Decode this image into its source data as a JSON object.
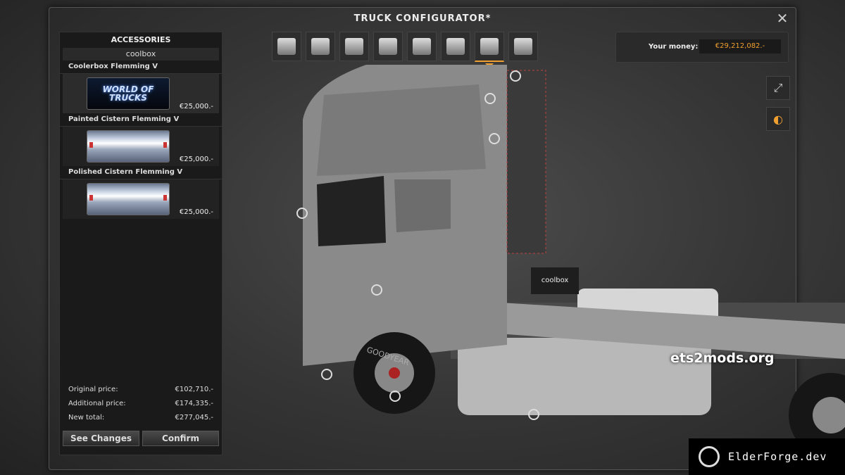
{
  "window": {
    "title": "TRUCK CONFIGURATOR*",
    "close_glyph": "✕"
  },
  "sidebar": {
    "header": "ACCESSORIES",
    "search_value": "coolbox",
    "items": [
      {
        "name": "Coolerbox Flemming V",
        "thumb": "world-of-trucks-logo",
        "thumb_text": "WORLD OF TRUCKS",
        "price": "€25,000.-"
      },
      {
        "name": "Painted Cistern Flemming V",
        "thumb": "painted-cistern",
        "price": "€25,000.-"
      },
      {
        "name": "Polished Cistern Flemming V",
        "thumb": "polished-cistern",
        "price": "€25,000.-"
      }
    ],
    "totals": {
      "original_label": "Original price:",
      "original_value": "€102,710.-",
      "additional_label": "Additional price:",
      "additional_value": "€174,335.-",
      "new_label": "New total:",
      "new_value": "€277,045.-"
    },
    "buttons": {
      "see_changes": "See Changes",
      "confirm": "Confirm"
    }
  },
  "toolbar": {
    "tools": [
      {
        "id": "cabin",
        "icon": "truck-cabin-icon"
      },
      {
        "id": "chassis",
        "icon": "chassis-icon"
      },
      {
        "id": "engine",
        "icon": "engine-icon"
      },
      {
        "id": "transmission",
        "icon": "transmission-icon"
      },
      {
        "id": "interior",
        "icon": "interior-icon"
      },
      {
        "id": "front",
        "icon": "truck-front-icon"
      },
      {
        "id": "accessories",
        "icon": "accessories-icon",
        "active": true
      },
      {
        "id": "interior-accessories",
        "icon": "interior-accessories-icon"
      }
    ],
    "accent": "#f0a030"
  },
  "money": {
    "label": "Your money:",
    "value": "€29,212,082.-"
  },
  "scene": {
    "tooltip": "coolbox",
    "watermark": "ets2mods.org",
    "badge": "ElderForge.dev",
    "tire_text": "GOODYEAR"
  },
  "side_buttons": {
    "fullscreen_glyph": "⤢",
    "lights_glyph": "◐"
  }
}
